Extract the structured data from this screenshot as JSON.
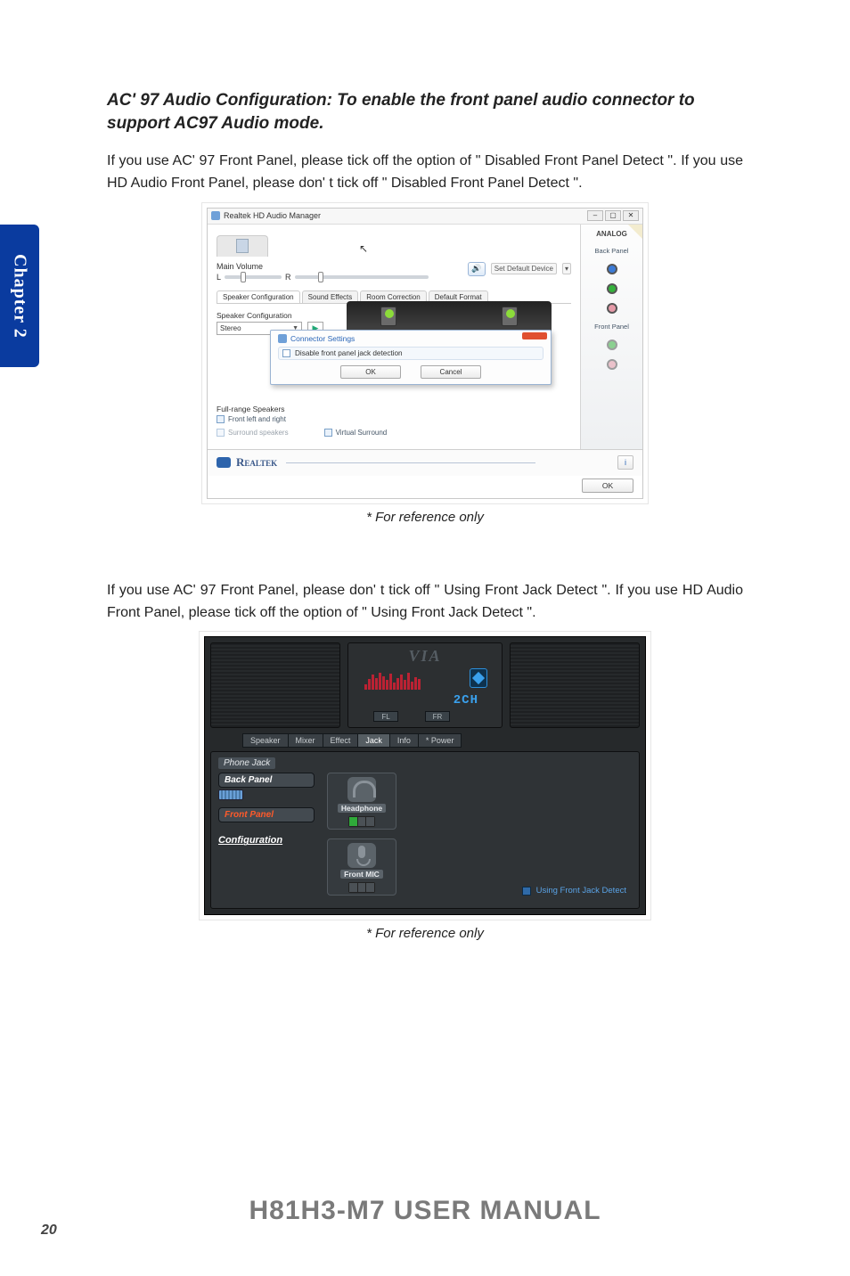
{
  "chapter_tab": "Chapter 2",
  "heading": "AC' 97 Audio Configuration: To enable the front panel audio connector to support AC97 Audio mode.",
  "para1": "If you use AC' 97 Front Panel, please tick off the option of \" Disabled Front Panel Detect \". If you use HD Audio Front Panel, please don' t tick off \" Disabled Front Panel Detect \".",
  "caption": "* For reference only",
  "para2": "If you use AC' 97 Front Panel, please don' t tick off \" Using Front Jack Detect \". If you use HD Audio Front Panel, please tick off the option of \" Using Front Jack Detect \".",
  "footer_title": "H81H3-M7 USER MANUAL",
  "page_number": "20",
  "fig1": {
    "window_title": "Realtek HD Audio Manager",
    "main_volume_label": "Main Volume",
    "balance_left": "L",
    "balance_right": "R",
    "set_default_label": "Set Default Device",
    "tabs": {
      "t1": "Speaker Configuration",
      "t2": "Sound Effects",
      "t3": "Room Correction",
      "t4": "Default Format"
    },
    "speaker_cfg_label": "Speaker Configuration",
    "speaker_mode": "Stereo",
    "dialog_title": "Connector Settings",
    "dialog_checkbox": "Disable front panel jack detection",
    "dialog_ok": "OK",
    "dialog_cancel": "Cancel",
    "full_range_label": "Full-range Speakers",
    "front_lr_label": "Front left and right",
    "surround_label": "Surround speakers",
    "virtual_surround_label": "Virtual Surround",
    "brand": "Realtek",
    "bottom_ok": "OK",
    "side_analog": "ANALOG",
    "side_back": "Back Panel",
    "side_front": "Front Panel"
  },
  "fig2": {
    "brand": "VIA",
    "channel_text": "2CH",
    "fl": "FL",
    "fr": "FR",
    "tabs": {
      "t1": "Speaker",
      "t2": "Mixer",
      "t3": "Effect",
      "t4": "Jack",
      "t5": "Info",
      "t6": "* Power"
    },
    "phone_jack": "Phone Jack",
    "back_panel": "Back Panel",
    "front_panel": "Front Panel",
    "configuration": "Configuration",
    "headphone": "Headphone",
    "front_mic": "Front MIC",
    "using_front_jack": "Using Front Jack Detect"
  }
}
